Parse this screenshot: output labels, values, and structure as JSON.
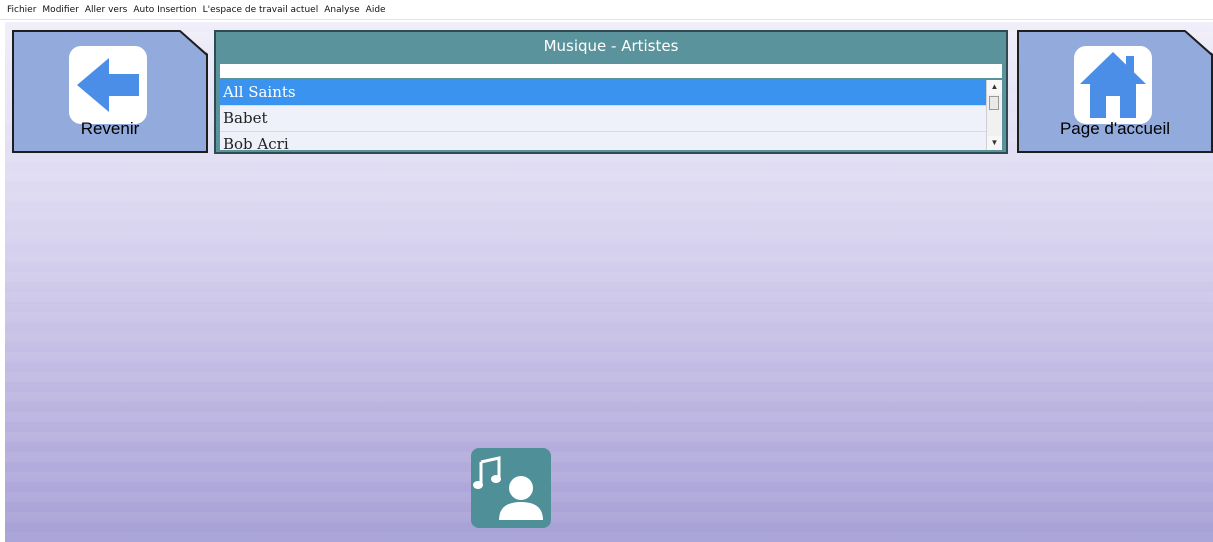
{
  "menu": {
    "items": [
      {
        "label": "Fichier"
      },
      {
        "label": "Modifier"
      },
      {
        "label": "Aller vers"
      },
      {
        "label": "Auto Insertion"
      },
      {
        "label": "L'espace de travail actuel"
      },
      {
        "label": "Analyse"
      },
      {
        "label": "Aide"
      }
    ]
  },
  "back_tile": {
    "label": "Revenir",
    "icon": "arrow-left-icon"
  },
  "home_tile": {
    "label": "Page d'accueil",
    "icon": "house-icon"
  },
  "list": {
    "title": "Musique - Artistes",
    "items": [
      {
        "label": "All Saints",
        "selected": true
      },
      {
        "label": "Babet",
        "selected": false
      },
      {
        "label": "Bob Acri",
        "selected": false
      }
    ]
  },
  "artist_tile": {
    "icon": "music-artist-icon"
  },
  "colors": {
    "tile": "#92abdc",
    "panel": "#5a939c",
    "selection": "#3b93f0",
    "arrow": "#4a8ee8"
  }
}
